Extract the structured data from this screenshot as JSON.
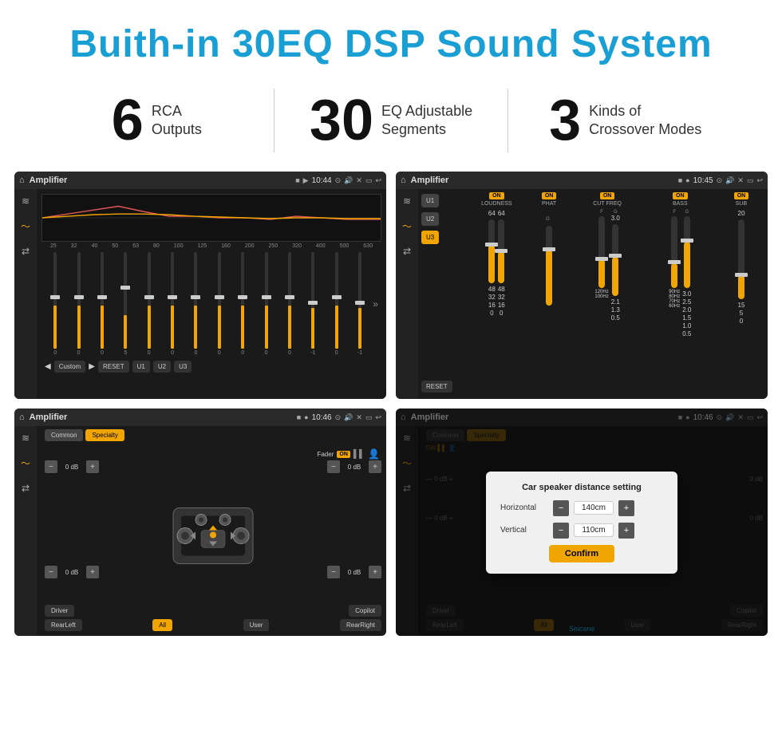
{
  "header": {
    "title": "Buith-in 30EQ DSP Sound System"
  },
  "stats": [
    {
      "number": "6",
      "text_line1": "RCA",
      "text_line2": "Outputs"
    },
    {
      "number": "30",
      "text_line1": "EQ Adjustable",
      "text_line2": "Segments"
    },
    {
      "number": "3",
      "text_line1": "Kinds of",
      "text_line2": "Crossover Modes"
    }
  ],
  "screens": {
    "eq": {
      "topbar": {
        "title": "Amplifier",
        "time": "10:44"
      },
      "eq_labels": [
        "25",
        "32",
        "40",
        "50",
        "63",
        "80",
        "100",
        "125",
        "160",
        "200",
        "250",
        "320",
        "400",
        "500",
        "630"
      ],
      "eq_values": [
        "0",
        "0",
        "0",
        "5",
        "0",
        "0",
        "0",
        "0",
        "0",
        "0",
        "0",
        "-1",
        "0",
        "-1"
      ],
      "bottom_buttons": [
        "Custom",
        "RESET",
        "U1",
        "U2",
        "U3"
      ]
    },
    "amplifier": {
      "topbar": {
        "title": "Amplifier",
        "time": "10:45"
      },
      "channels": [
        "U1",
        "U2",
        "U3"
      ],
      "controls": [
        "LOUDNESS",
        "PHAT",
        "CUT FREQ",
        "BASS",
        "SUB"
      ],
      "reset_label": "RESET"
    },
    "specialty": {
      "topbar": {
        "title": "Amplifier",
        "time": "10:46"
      },
      "tabs": [
        "Common",
        "Specialty"
      ],
      "active_tab": "Specialty",
      "fader_label": "Fader",
      "fader_on": "ON",
      "db_values": [
        "0 dB",
        "0 dB",
        "0 dB",
        "0 dB"
      ],
      "buttons": [
        "Driver",
        "RearLeft",
        "All",
        "User",
        "Copilot",
        "RearRight"
      ]
    },
    "dialog": {
      "topbar": {
        "title": "Amplifier",
        "time": "10:46"
      },
      "tabs": [
        "Common",
        "Specialty"
      ],
      "dialog_title": "Car speaker distance setting",
      "horizontal_label": "Horizontal",
      "horizontal_value": "140cm",
      "vertical_label": "Vertical",
      "vertical_value": "110cm",
      "confirm_label": "Confirm",
      "db_values": [
        "0 dB",
        "0 dB"
      ],
      "buttons": [
        "Driver",
        "RearLeft",
        "User",
        "Copilot",
        "RearRight"
      ]
    }
  },
  "watermark": "Seicane"
}
